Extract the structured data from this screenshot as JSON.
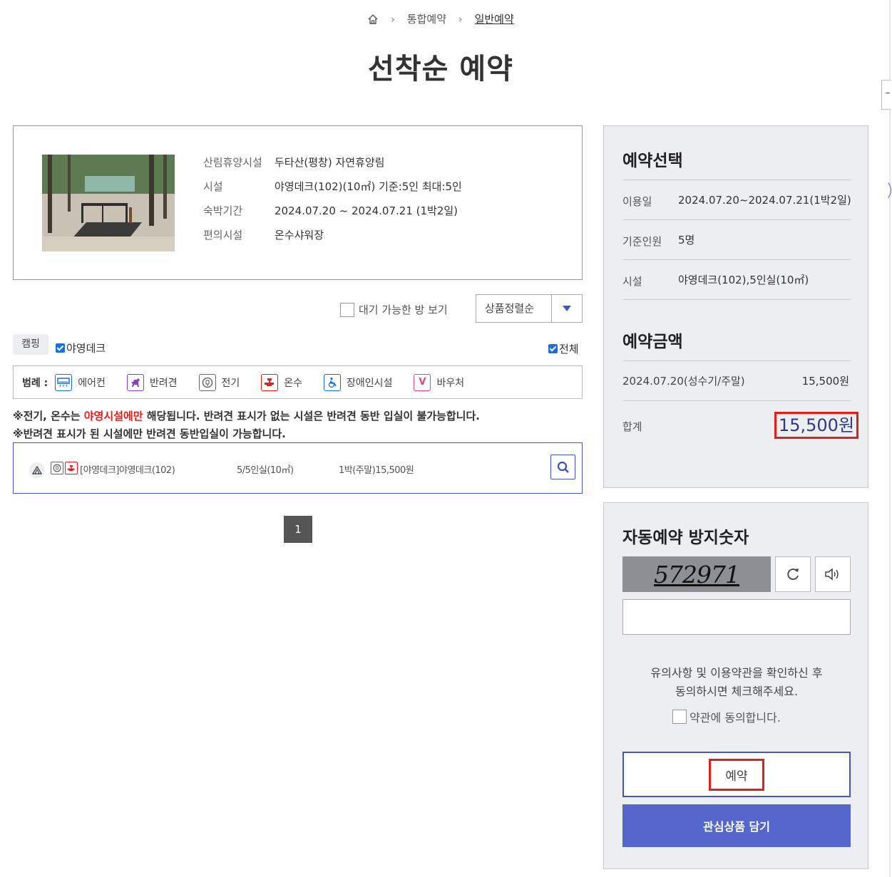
{
  "breadcrumb": {
    "level1": "통합예약",
    "level2": "일반예약"
  },
  "page_title": "선착순 예약",
  "facility_info": {
    "rows": [
      {
        "label": "산림휴양시설",
        "value": "두타산(평창) 자연휴양림"
      },
      {
        "label": "시설",
        "value": "야영데크(102)(10㎡) 기준:5인 최대:5인"
      },
      {
        "label": "숙박기간",
        "value": "2024.07.20 ~ 2024.07.21 (1박2일)"
      },
      {
        "label": "편의시설",
        "value": "온수샤워장"
      }
    ]
  },
  "filters": {
    "wait_label": "대기 가능한 방 보기",
    "sort_label": "상품정렬순",
    "tab_label": "캠핑",
    "deck_label": "야영데크",
    "all_label": "전체"
  },
  "legend": {
    "title": "범례 :",
    "items": [
      "에어컨",
      "반려견",
      "전기",
      "온수",
      "장애인시설",
      "바우처"
    ]
  },
  "notes": {
    "line1_prefix": "※전기, 온수는 ",
    "line1_red": "야영시설에만",
    "line1_suffix": " 해당됩니다. 반려견 표시가 없는 시설은 반려견 동반 입실이 불가능합니다.",
    "line2": "※반려견 표시가 된 시설에만 반려견 동반입실이 가능합니다."
  },
  "facility_row": {
    "name": "[야영데크]야영데크(102)",
    "capacity": "5/5인실(10㎡)",
    "price": "1박(주말)15,500원"
  },
  "pager": {
    "current": "1"
  },
  "reservation": {
    "title": "예약선택",
    "rows": [
      {
        "label": "이용일",
        "value": "2024.07.20~2024.07.21(1박2일)"
      },
      {
        "label": "기준인원",
        "value": "5명"
      },
      {
        "label": "시설",
        "value": "야영데크(102),5인실(10㎡)"
      }
    ],
    "amount_title": "예약금액",
    "amount_row": {
      "label": "2024.07.20(성수기/주말)",
      "value": "15,500원"
    },
    "total_label": "합계",
    "total_value": "15,500원"
  },
  "captcha": {
    "title": "자동예약 방지숫자",
    "code": "572971",
    "input_value": "",
    "agree_line1": "유의사항 및 이용약관을 확인하신 후",
    "agree_line2": "동의하시면 체크해주세요.",
    "agree_check_label": "약관에 동의합니다.",
    "reserve_label": "예약",
    "wish_label": "관심상품 담기"
  },
  "colors": {
    "accent": "#5566cc",
    "highlight_red": "#e0201a",
    "border_blue": "#4856b8"
  }
}
